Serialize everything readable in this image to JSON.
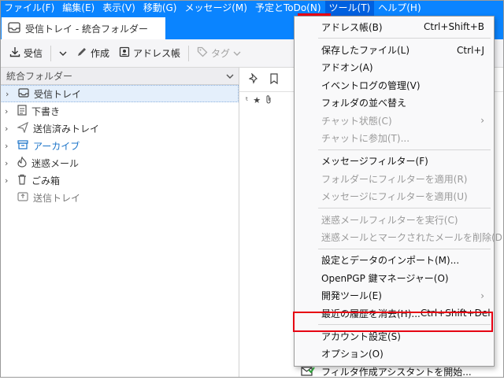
{
  "menubar": {
    "items": [
      "ファイル(F)",
      "編集(E)",
      "表示(V)",
      "移動(G)",
      "メッセージ(M)",
      "予定とToDo(N)",
      "ツール(T)",
      "ヘルプ(H)"
    ]
  },
  "tab": {
    "label": "受信トレイ - 統合フォルダー"
  },
  "toolbar": {
    "get_mail": "受信",
    "write": "作成",
    "address_book": "アドレス帳",
    "tag": "タグ"
  },
  "folder_pane": {
    "header": "統合フォルダー",
    "folders": [
      {
        "label": "受信トレイ",
        "icon": "inbox-icon"
      },
      {
        "label": "下書き",
        "icon": "draft-icon"
      },
      {
        "label": "送信済みトレイ",
        "icon": "sent-icon"
      },
      {
        "label": "アーカイブ",
        "icon": "archive-icon"
      },
      {
        "label": "迷惑メール",
        "icon": "junk-icon"
      },
      {
        "label": "ごみ箱",
        "icon": "trash-icon"
      },
      {
        "label": "送信トレイ",
        "icon": "outbox-icon"
      }
    ]
  },
  "tools_menu": {
    "items": [
      {
        "label": "アドレス帳(B)",
        "accel": "Ctrl+Shift+B"
      },
      {
        "label": "保存したファイル(L)",
        "accel": "Ctrl+J"
      },
      {
        "label": "アドオン(A)"
      },
      {
        "label": "イベントログの管理(V)"
      },
      {
        "label": "フォルダの並べ替え"
      },
      {
        "label": "チャット状態(C)",
        "arrow": "›"
      },
      {
        "label": "チャットに参加(T)..."
      },
      {
        "label": "メッセージフィルター(F)"
      },
      {
        "label": "フォルダーにフィルターを適用(R)"
      },
      {
        "label": "メッセージにフィルターを適用(U)"
      },
      {
        "label": "迷惑メールフィルターを実行(C)"
      },
      {
        "label": "迷惑メールとマークされたメールを削除(D)"
      },
      {
        "label": "設定とデータのインポート(M)..."
      },
      {
        "label": "OpenPGP 鍵マネージャー(O)"
      },
      {
        "label": "開発ツール(E)",
        "arrow": "›"
      },
      {
        "label": "最近の履歴を消去(H)...",
        "accel": "Ctrl+Shift+Del"
      },
      {
        "label": "アカウント設定(S)"
      },
      {
        "label": "オプション(O)"
      },
      {
        "label": "フィルタ作成アシスタントを開始..."
      }
    ]
  },
  "colors": {
    "accent": "#0a84ff",
    "highlight": "#e60012"
  }
}
